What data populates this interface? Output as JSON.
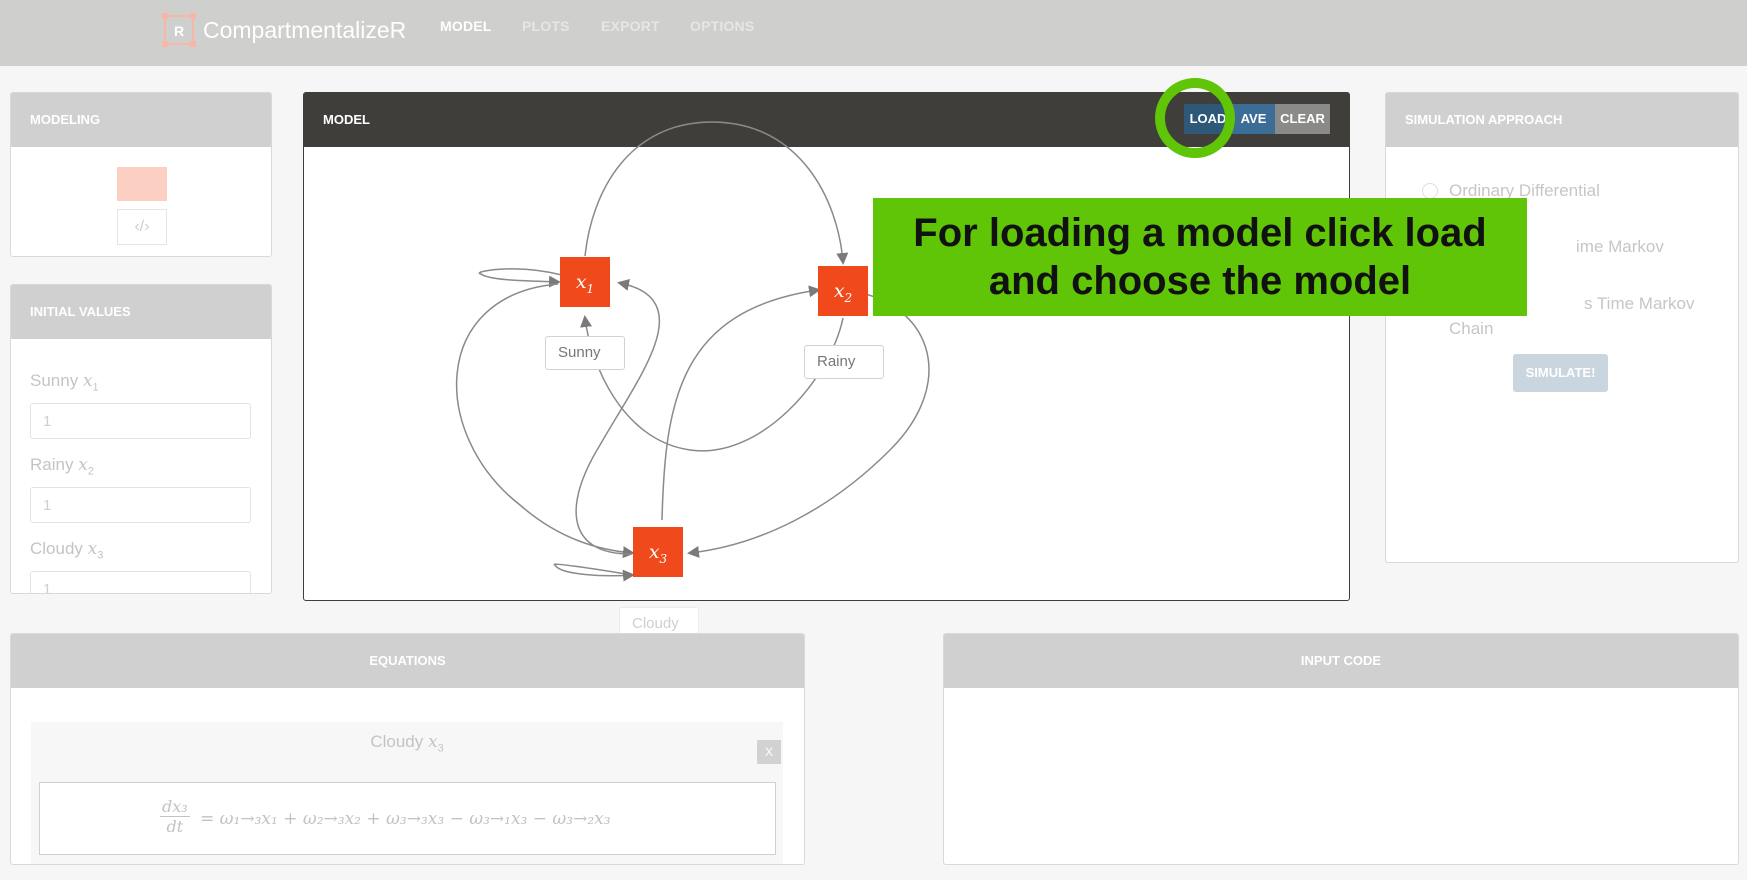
{
  "app": {
    "name": "CompartmentalizeR",
    "logo_letter": "R"
  },
  "nav": {
    "items": [
      "MODEL",
      "PLOTS",
      "EXPORT",
      "OPTIONS"
    ],
    "active": "MODEL"
  },
  "modeling_panel": {
    "title": "MODELING",
    "tools": [
      "compartment-tool",
      "flow-arrow-tool"
    ],
    "flow_symbol": "‹/›"
  },
  "initial_values": {
    "title": "INITIAL VALUES",
    "fields": [
      {
        "name": "Sunny",
        "var": "x",
        "sub": "1",
        "value": "1"
      },
      {
        "name": "Rainy",
        "var": "x",
        "sub": "2",
        "value": "1"
      },
      {
        "name": "Cloudy",
        "var": "x",
        "sub": "3",
        "value": "1"
      }
    ]
  },
  "model_panel": {
    "title": "MODEL",
    "buttons": {
      "load": "LOAD",
      "save": "SAVE",
      "save_visible": "AVE",
      "clear": "CLEAR"
    },
    "nodes": [
      {
        "var": "x",
        "sub": "1",
        "label": "Sunny"
      },
      {
        "var": "x",
        "sub": "2",
        "label": "Rainy"
      },
      {
        "var": "x",
        "sub": "3",
        "label": "Cloudy"
      }
    ]
  },
  "callout": {
    "line1": "For loading a model click load",
    "line2": "and choose the model",
    "color": "#5fc506"
  },
  "simulation": {
    "title": "SIMULATION APPROACH",
    "options": [
      "Ordinary Differential",
      "Discrete Time Markov",
      "Continuous Time Markov Chain"
    ],
    "options_visible": [
      "Ordinary Differential",
      "ime Markov",
      "s Time Markov",
      "Chain"
    ],
    "button": "SIMULATE!"
  },
  "equations": {
    "title": "EQUATIONS",
    "card_title": "Cloudy",
    "card_var": "x",
    "card_sub": "3",
    "close_label": "X",
    "formula_lhs_num": "dx₃",
    "formula_lhs_den": "dt",
    "formula_rhs": "= ω₁→₃x₁ + ω₂→₃x₂ + ω₃→₃x₃ − ω₃→₁x₃ − ω₃→₂x₃"
  },
  "input_code": {
    "title": "INPUT CODE"
  },
  "colors": {
    "node": "#f04a1c",
    "load_button": "#2d5878",
    "save_button": "#3b6d97",
    "clear_button": "#8a8a88",
    "model_header": "#3f3e3a"
  }
}
